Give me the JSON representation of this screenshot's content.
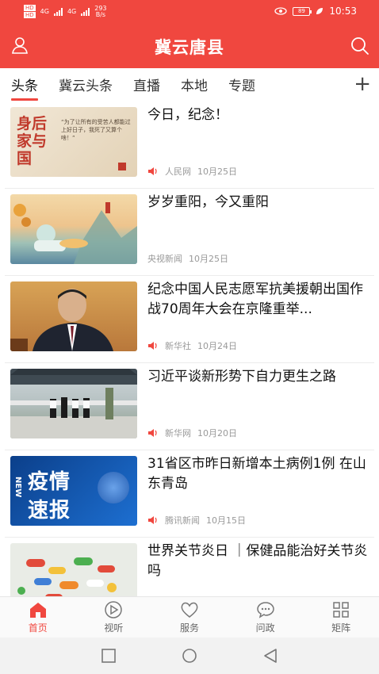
{
  "status_bar": {
    "sim1": "HD",
    "sim2": "HD",
    "net1": "4G",
    "net2": "4G",
    "speed_value": "293",
    "speed_unit": "B/s",
    "battery": "89",
    "time": "10:53"
  },
  "header": {
    "title": "冀云唐县",
    "user_icon": "user-icon",
    "search_icon": "search-icon"
  },
  "tabs": [
    {
      "label": "头条",
      "active": true
    },
    {
      "label": "冀云头条",
      "active": false
    },
    {
      "label": "直播",
      "active": false
    },
    {
      "label": "本地",
      "active": false
    },
    {
      "label": "专题",
      "active": false
    }
  ],
  "tab_add_label": "+",
  "articles": [
    {
      "title": "今日，纪念！",
      "source": "人民网",
      "date": "10月25日",
      "audio": true
    },
    {
      "title": "岁岁重阳，今又重阳",
      "source": "央视新闻",
      "date": "10月25日",
      "audio": false
    },
    {
      "title": "纪念中国人民志愿军抗美援朝出国作战70周年大会在京隆重举...",
      "source": "新华社",
      "date": "10月24日",
      "audio": true
    },
    {
      "title": "习近平谈新形势下自力更生之路",
      "source": "新华网",
      "date": "10月20日",
      "audio": true
    },
    {
      "title": "31省区市昨日新增本土病例1例 在山东青岛",
      "source": "腾讯新闻",
      "date": "10月15日",
      "audio": true
    },
    {
      "title": "世界关节炎日 ｜保健品能治好关节炎吗",
      "source": "",
      "date": "",
      "audio": false
    }
  ],
  "thumb_text": {
    "a1_big": "身后家与国",
    "a1_quote": "“为了让所有的受苦人都能过上好日子，我死了又算个啥！”",
    "a5_line1": "疫情",
    "a5_line2": "速报",
    "a5_new": "NEW"
  },
  "bottom_nav": [
    {
      "label": "首页",
      "icon": "home-icon",
      "active": true
    },
    {
      "label": "视听",
      "icon": "play-icon",
      "active": false
    },
    {
      "label": "服务",
      "icon": "heart-icon",
      "active": false
    },
    {
      "label": "问政",
      "icon": "chat-icon",
      "active": false
    },
    {
      "label": "矩阵",
      "icon": "grid-icon",
      "active": false
    }
  ],
  "colors": {
    "accent": "#f0473f"
  }
}
